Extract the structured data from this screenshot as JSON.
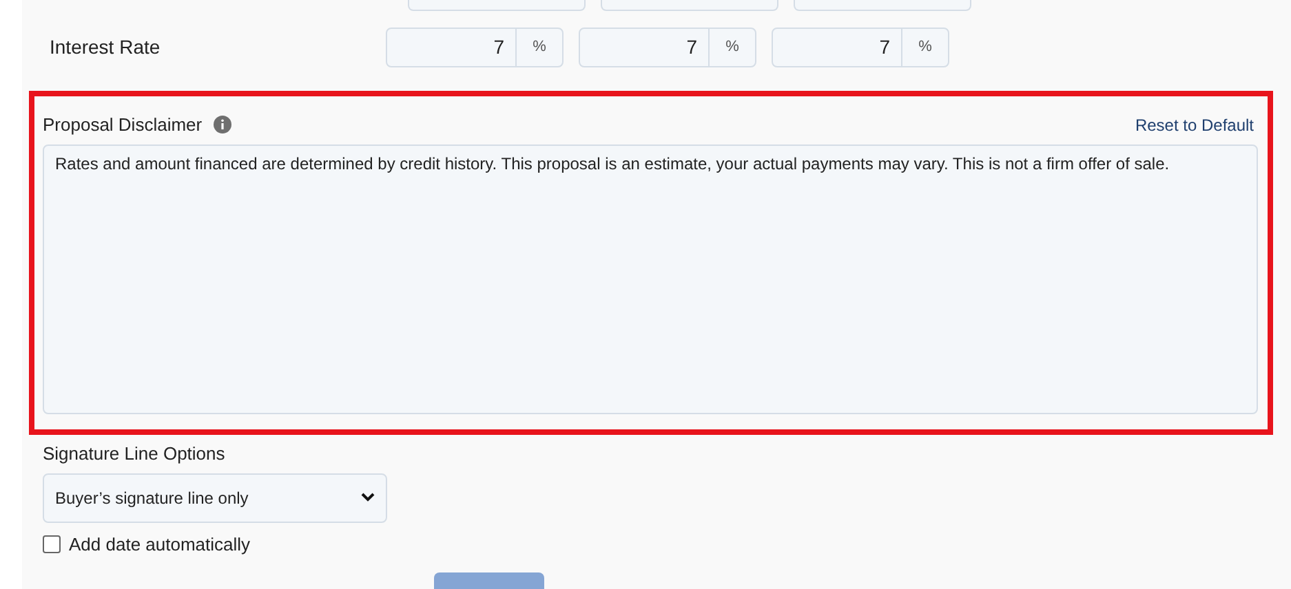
{
  "rate_row": {
    "label": "Interest Rate",
    "fields": [
      {
        "value": "7",
        "unit": "%"
      },
      {
        "value": "7",
        "unit": "%"
      },
      {
        "value": "7",
        "unit": "%"
      }
    ]
  },
  "disclaimer": {
    "label": "Proposal Disclaimer",
    "reset_link": "Reset to Default",
    "value": "Rates and amount financed are determined by credit history. This proposal is an estimate, your actual payments may vary. This is not a firm offer of sale.",
    "highlighted": true
  },
  "signature": {
    "label": "Signature Line Options",
    "selected_option": "Buyer’s signature line only"
  },
  "add_date": {
    "label": "Add date automatically",
    "checked": false
  }
}
